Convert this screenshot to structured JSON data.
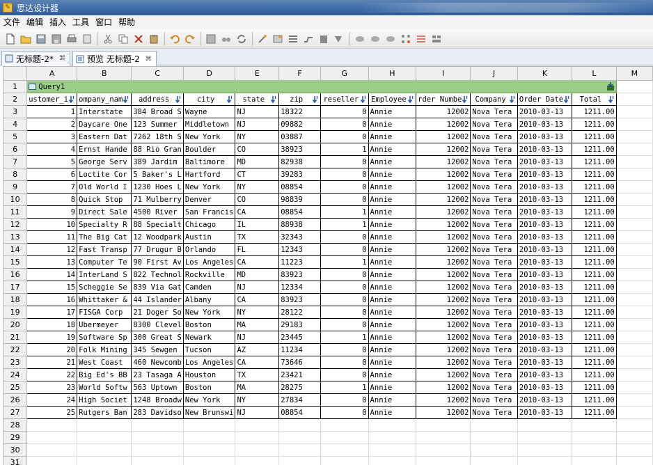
{
  "window": {
    "title": "思达设计器"
  },
  "menu": [
    "文件",
    "编辑",
    "插入",
    "工具",
    "窗口",
    "帮助"
  ],
  "tabs": [
    {
      "label": "无标题-2*",
      "active": false
    },
    {
      "label": "预览 无标题-2",
      "active": true
    }
  ],
  "sheet": {
    "columns": [
      "A",
      "B",
      "C",
      "D",
      "E",
      "F",
      "G",
      "H",
      "I",
      "J",
      "K",
      "L",
      "M"
    ],
    "query_label": "Query1",
    "field_headers": [
      "ustomer_i",
      "ompany_nam",
      "address",
      "city",
      "state",
      "zip",
      "reseller",
      "Employee",
      "rder Numbe",
      "Company",
      "Order Date",
      "Total"
    ],
    "rows": [
      [
        "1",
        "Interstate",
        "384 Broad S",
        "Wayne",
        "NJ",
        "18322",
        "0",
        "Annie",
        "12002",
        "Nova Tera",
        "2010-03-13",
        "1211.00"
      ],
      [
        "2",
        "Daycare One",
        "123 Summer",
        "Middletown",
        "NJ",
        "09882",
        "0",
        "Annie",
        "12002",
        "Nova Tera",
        "2010-03-13",
        "1211.00"
      ],
      [
        "3",
        "Eastern Dat",
        "7262 18th S",
        "New York",
        "NY",
        "03887",
        "0",
        "Annie",
        "12002",
        "Nova Tera",
        "2010-03-13",
        "1211.00"
      ],
      [
        "4",
        "Ernst Hande",
        "88 Rio Gran",
        "Boulder",
        "CO",
        "38923",
        "1",
        "Annie",
        "12002",
        "Nova Tera",
        "2010-03-13",
        "1211.00"
      ],
      [
        "5",
        "George Serv",
        "389 Jardim",
        "Baltimore",
        "MD",
        "82938",
        "0",
        "Annie",
        "12002",
        "Nova Tera",
        "2010-03-13",
        "1211.00"
      ],
      [
        "6",
        "Loctite Cor",
        "5 Baker's L",
        "Hartford",
        "CT",
        "39283",
        "0",
        "Annie",
        "12002",
        "Nova Tera",
        "2010-03-13",
        "1211.00"
      ],
      [
        "7",
        "Old World I",
        "1230 Hoes L",
        "New York",
        "NY",
        "08854",
        "0",
        "Annie",
        "12002",
        "Nova Tera",
        "2010-03-13",
        "1211.00"
      ],
      [
        "8",
        "Quick Stop",
        "71 Mulberry",
        "Denver",
        "CO",
        "98839",
        "0",
        "Annie",
        "12002",
        "Nova Tera",
        "2010-03-13",
        "1211.00"
      ],
      [
        "9",
        "Direct Sale",
        "4500 River",
        "San Francis",
        "CA",
        "08854",
        "1",
        "Annie",
        "12002",
        "Nova Tera",
        "2010-03-13",
        "1211.00"
      ],
      [
        "10",
        "Specialty R",
        "88 Specialt",
        "Chicago",
        "IL",
        "88938",
        "1",
        "Annie",
        "12002",
        "Nova Tera",
        "2010-03-13",
        "1211.00"
      ],
      [
        "11",
        "The Big Cat",
        "12 Woodpark",
        "Austin",
        "TX",
        "32343",
        "0",
        "Annie",
        "12002",
        "Nova Tera",
        "2010-03-13",
        "1211.00"
      ],
      [
        "12",
        "Fast Transp",
        "77 Drugur B",
        "Orlando",
        "FL",
        "12343",
        "0",
        "Annie",
        "12002",
        "Nova Tera",
        "2010-03-13",
        "1211.00"
      ],
      [
        "13",
        "Computer Te",
        "90 First Av",
        "Los Angeles",
        "CA",
        "11223",
        "1",
        "Annie",
        "12002",
        "Nova Tera",
        "2010-03-13",
        "1211.00"
      ],
      [
        "14",
        "InterLand S",
        "822 Technol",
        "Rockville",
        "MD",
        "83923",
        "0",
        "Annie",
        "12002",
        "Nova Tera",
        "2010-03-13",
        "1211.00"
      ],
      [
        "15",
        "Scheggie Se",
        "839 Via Gat",
        "Camden",
        "NJ",
        "12334",
        "0",
        "Annie",
        "12002",
        "Nova Tera",
        "2010-03-13",
        "1211.00"
      ],
      [
        "16",
        "Whittaker &",
        "44 Islander",
        "Albany",
        "CA",
        "83923",
        "0",
        "Annie",
        "12002",
        "Nova Tera",
        "2010-03-13",
        "1211.00"
      ],
      [
        "17",
        "FISGA Corp",
        "21 Doger So",
        "New York",
        "NY",
        "28122",
        "0",
        "Annie",
        "12002",
        "Nova Tera",
        "2010-03-13",
        "1211.00"
      ],
      [
        "18",
        "Ubermeyer",
        "8300 Clevel",
        "Boston",
        "MA",
        "29183",
        "0",
        "Annie",
        "12002",
        "Nova Tera",
        "2010-03-13",
        "1211.00"
      ],
      [
        "19",
        "Software Sp",
        "300 Great S",
        "Newark",
        "NJ",
        "23445",
        "1",
        "Annie",
        "12002",
        "Nova Tera",
        "2010-03-13",
        "1211.00"
      ],
      [
        "20",
        "Folk Mining",
        "345 Sewgen",
        "Tucson",
        "AZ",
        "11234",
        "0",
        "Annie",
        "12002",
        "Nova Tera",
        "2010-03-13",
        "1211.00"
      ],
      [
        "21",
        "West Coast",
        "460 Newcomb",
        "Los Angeles",
        "CA",
        "73646",
        "0",
        "Annie",
        "12002",
        "Nova Tera",
        "2010-03-13",
        "1211.00"
      ],
      [
        "22",
        "Big Ed's BB",
        "23 Tasaga A",
        "Houston",
        "TX",
        "23421",
        "0",
        "Annie",
        "12002",
        "Nova Tera",
        "2010-03-13",
        "1211.00"
      ],
      [
        "23",
        "World Softw",
        "563 Uptown",
        "Boston",
        "MA",
        "28275",
        "1",
        "Annie",
        "12002",
        "Nova Tera",
        "2010-03-13",
        "1211.00"
      ],
      [
        "24",
        "High Societ",
        "1248 Broadw",
        "New York",
        "NY",
        "27834",
        "0",
        "Annie",
        "12002",
        "Nova Tera",
        "2010-03-13",
        "1211.00"
      ],
      [
        "25",
        "Rutgers Ban",
        "283 Davidso",
        "New Brunswi",
        "NJ",
        "08854",
        "0",
        "Annie",
        "12002",
        "Nova Tera",
        "2010-03-13",
        "1211.00"
      ]
    ],
    "numeric_columns": [
      0,
      6,
      8,
      11
    ],
    "empty_row_numbers": [
      "28",
      "29",
      "30",
      "31"
    ],
    "colors": {
      "query_band": "#9bcf88",
      "field_arrow": "#2a5ca8",
      "header_bg": "#f0f0f0"
    }
  }
}
